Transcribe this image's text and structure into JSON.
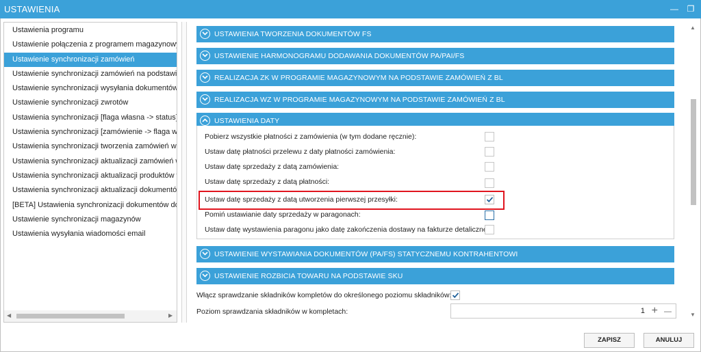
{
  "window": {
    "title": "USTAWIENIA",
    "minimize_glyph": "—",
    "maximize_glyph": "❐"
  },
  "sidebar": {
    "items": [
      {
        "label": "Ustawienia programu"
      },
      {
        "label": "Ustawienie połączenia z programem magazynowym"
      },
      {
        "label": "Ustawienie synchronizacji zamówień",
        "selected": true
      },
      {
        "label": "Ustawienie synchronizacji zamówień na podstawie dzi"
      },
      {
        "label": "Ustawienie synchronizacji wysyłania dokumentów"
      },
      {
        "label": "Ustawienie synchronizacji zwrotów"
      },
      {
        "label": "Ustawienia synchronizacji [flaga własna -> status]"
      },
      {
        "label": "Ustawienia synchronizacji [zamówienie -> flaga własn"
      },
      {
        "label": "Ustawienia synchronizacji tworzenia zamówień w Base"
      },
      {
        "label": "Ustawienia synchronizacji aktualizacji zamówień w Bas"
      },
      {
        "label": "Ustawienia synchronizacji aktualizacji produktów w Ba"
      },
      {
        "label": "Ustawienia synchronizacji aktualizacji dokumentów"
      },
      {
        "label": "[BETA] Ustawienia synchronizacji dokumentów dostaw"
      },
      {
        "label": "Ustawienie synchronizacji magazynów"
      },
      {
        "label": "Ustawienia wysyłania wiadomości email"
      }
    ]
  },
  "sections": {
    "s1": {
      "label": "USTAWIENIA TWORZENIA DOKUMENTÓW FS",
      "expanded": false
    },
    "s2": {
      "label": "USTAWIENIE HARMONOGRAMU DODAWANIA DOKUMENTÓW PA/PAI/FS",
      "expanded": false
    },
    "s3": {
      "label": "REALIZACJA ZK W PROGRAMIE MAGAZYNOWYM NA PODSTAWIE ZAMÓWIEŃ Z BL",
      "expanded": false
    },
    "s4": {
      "label": "REALIZACJA WZ W PROGRAMIE MAGAZYNOWYM NA PODSTAWIE ZAMÓWIEŃ Z BL",
      "expanded": false
    },
    "s5": {
      "label": "USTAWIENIA DATY",
      "expanded": true
    },
    "s6": {
      "label": "USTAWIENIE WYSTAWIANIA DOKUMENTÓW (PA/FS) STATYCZNEMU KONTRAHENTOWI",
      "expanded": false
    },
    "s7": {
      "label": "USTAWIENIE ROZBICIA TOWARU NA PODSTAWIE SKU",
      "expanded": true
    }
  },
  "date_settings": {
    "r1": {
      "label": "Pobierz wszystkie płatności z zamówienia (w tym dodane ręcznie):",
      "checked": false
    },
    "r2": {
      "label": "Ustaw datę płatności przelewu z daty płatności zamówienia:",
      "checked": false
    },
    "r3": {
      "label": "Ustaw datę sprzedaży z datą zamówienia:",
      "checked": false
    },
    "r4": {
      "label": "Ustaw datę sprzedaży z datą płatności:",
      "checked": false
    },
    "r5": {
      "label": "Ustaw datę sprzedaży z datą utworzenia pierwszej przesyłki:",
      "checked": true
    },
    "r6": {
      "label": "Pomiń ustawianie daty sprzedaży w paragonach:",
      "checked": false
    },
    "r7": {
      "label": "Ustaw datę wystawienia paragonu jako datę zakończenia dostawy na fakturze detalicznej:",
      "checked": false
    }
  },
  "sku": {
    "check_label": "Włącz sprawdzanie składników kompletów do określonego poziomu składników:",
    "check_checked": true,
    "level_label": "Poziom sprawdzania składników w kompletach:",
    "level_value": "1",
    "plus_glyph": "+",
    "minus_glyph": "—"
  },
  "footer": {
    "save_label": "ZAPISZ",
    "cancel_label": "ANULUJ"
  },
  "colors": {
    "accent": "#3ba1d9",
    "highlight_border": "#e0141e"
  }
}
